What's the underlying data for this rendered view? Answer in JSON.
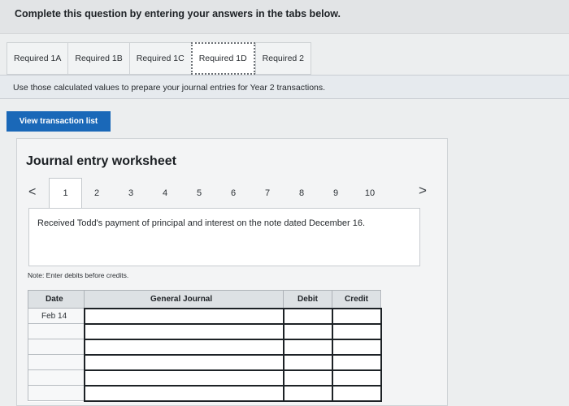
{
  "header": {
    "instruction": "Complete this question by entering your answers in the tabs below."
  },
  "tabs": [
    {
      "label": "Required 1A",
      "active": false
    },
    {
      "label": "Required 1B",
      "active": false
    },
    {
      "label": "Required 1C",
      "active": false
    },
    {
      "label": "Required 1D",
      "active": true
    },
    {
      "label": "Required 2",
      "active": false
    }
  ],
  "info": {
    "text": "Use those calculated values to prepare your journal entries for Year 2 transactions."
  },
  "transaction_button": {
    "label": "View transaction list"
  },
  "worksheet": {
    "title": "Journal entry worksheet",
    "prev_icon": "<",
    "next_icon": ">",
    "pages": [
      "1",
      "2",
      "3",
      "4",
      "5",
      "6",
      "7",
      "8",
      "9",
      "10"
    ],
    "active_page": "1",
    "description": "Received Todd's payment of principal and interest on the note dated December 16.",
    "note": "Note: Enter debits before credits.",
    "columns": {
      "date": "Date",
      "journal": "General Journal",
      "debit": "Debit",
      "credit": "Credit"
    },
    "rows": [
      {
        "date": "Feb 14",
        "account": "",
        "debit": "",
        "credit": ""
      },
      {
        "date": "",
        "account": "",
        "debit": "",
        "credit": ""
      },
      {
        "date": "",
        "account": "",
        "debit": "",
        "credit": ""
      },
      {
        "date": "",
        "account": "",
        "debit": "",
        "credit": ""
      },
      {
        "date": "",
        "account": "",
        "debit": "",
        "credit": ""
      },
      {
        "date": "",
        "account": "",
        "debit": "",
        "credit": ""
      }
    ]
  },
  "colors": {
    "button": "#1a68b8",
    "panel": "#f3f4f5",
    "background": "#eceeef"
  }
}
